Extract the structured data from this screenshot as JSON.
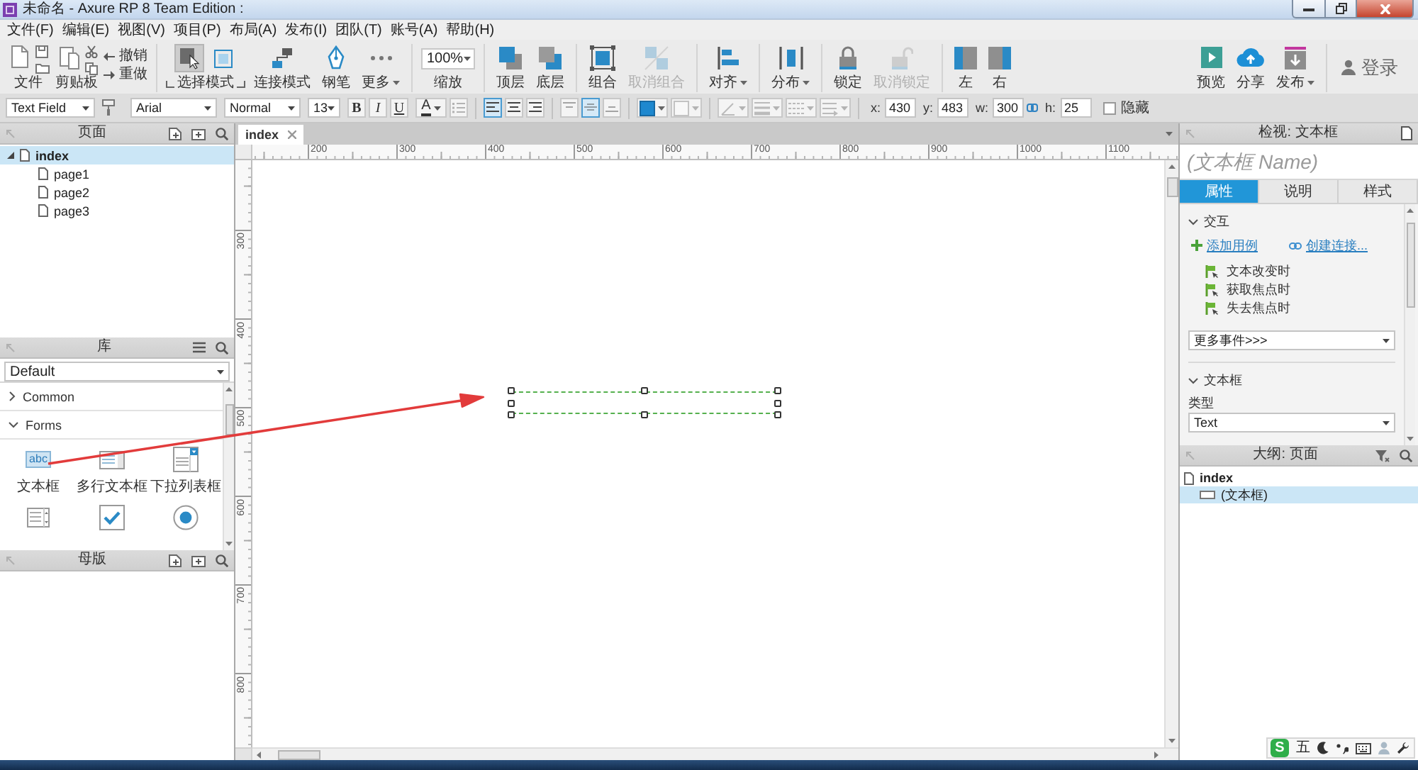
{
  "window": {
    "title": "未命名 - Axure RP 8 Team Edition :"
  },
  "menu": [
    "文件(F)",
    "编辑(E)",
    "视图(V)",
    "项目(P)",
    "布局(A)",
    "发布(I)",
    "团队(T)",
    "账号(A)",
    "帮助(H)"
  ],
  "toolbar": {
    "sections": [
      [
        {
          "kind": "file",
          "label": "文件"
        },
        {
          "kind": "clipboard",
          "label": "剪贴板"
        },
        {
          "kind": "history",
          "actions": [
            {
              "kind": "undo",
              "label": "撤销"
            },
            {
              "kind": "redo",
              "label": "重做"
            }
          ]
        }
      ],
      [
        {
          "kind": "select-mode",
          "label": "选择模式",
          "modes": [
            {
              "kind": "intersect",
              "selected": true
            },
            {
              "kind": "contain",
              "selected": false
            }
          ]
        },
        {
          "kind": "connect",
          "label": "连接模式",
          "dropdown": false,
          "disabled": false
        },
        {
          "kind": "pen",
          "label": "钢笔",
          "dropdown": false,
          "disabled": false
        },
        {
          "kind": "more",
          "label": "更多",
          "dropdown": true,
          "disabled": false
        }
      ],
      [
        {
          "kind": "zoom",
          "value": "100%",
          "label": "缩放"
        }
      ],
      [
        {
          "kind": "bring-to-front",
          "label": "顶层",
          "dropdown": false,
          "disabled": false
        },
        {
          "kind": "send-to-back",
          "label": "底层",
          "dropdown": false,
          "disabled": false
        }
      ],
      [
        {
          "kind": "group",
          "label": "组合",
          "dropdown": false,
          "disabled": false
        },
        {
          "kind": "ungroup",
          "label": "取消组合",
          "dropdown": false,
          "disabled": true
        }
      ],
      [
        {
          "kind": "align",
          "label": "对齐",
          "dropdown": true,
          "disabled": false
        }
      ],
      [
        {
          "kind": "distribute",
          "label": "分布",
          "dropdown": true,
          "disabled": false
        }
      ],
      [
        {
          "kind": "lock",
          "label": "锁定",
          "dropdown": false,
          "disabled": false
        },
        {
          "kind": "unlock",
          "label": "取消锁定",
          "dropdown": false,
          "disabled": true
        }
      ],
      [
        {
          "kind": "left-pane",
          "label": "左",
          "dropdown": false,
          "disabled": false
        },
        {
          "kind": "right-pane",
          "label": "右",
          "dropdown": false,
          "disabled": false
        }
      ]
    ],
    "right_sections": [
      [
        {
          "kind": "preview",
          "label": "预览",
          "dropdown": false,
          "disabled": false
        },
        {
          "kind": "share",
          "label": "分享",
          "dropdown": false,
          "disabled": false
        },
        {
          "kind": "publish",
          "label": "发布",
          "dropdown": true,
          "disabled": false
        }
      ],
      [
        {
          "kind": "login",
          "label": "登录"
        }
      ]
    ]
  },
  "format_bar": {
    "widget_type": "Text Field",
    "font_family": "Arial",
    "font_style": "Normal",
    "font_size": "13",
    "text_styles": [
      {
        "kind": "bold",
        "label": "B"
      },
      {
        "kind": "italic",
        "label": "I"
      },
      {
        "kind": "underline",
        "label": "U"
      }
    ],
    "font_color": "A",
    "bullets": {
      "disabled": true
    },
    "horizontal_align": [
      {
        "kind": "left",
        "selected": true
      },
      {
        "kind": "center",
        "selected": false
      },
      {
        "kind": "right",
        "selected": false
      }
    ],
    "vertical_align": [
      {
        "kind": "top",
        "selected": false,
        "disabled": true
      },
      {
        "kind": "middle",
        "selected": true,
        "disabled": true
      },
      {
        "kind": "bottom",
        "selected": false,
        "disabled": true
      }
    ],
    "style_tools": [
      {
        "kind": "fill",
        "disabled": false
      },
      {
        "kind": "border",
        "disabled": true
      },
      {
        "kind": "line",
        "disabled": true
      },
      {
        "kind": "line-weight",
        "disabled": true
      },
      {
        "kind": "line-pattern",
        "disabled": true
      },
      {
        "kind": "arrow-style",
        "disabled": true
      }
    ],
    "position": [
      {
        "kind": "x",
        "label": "x:",
        "value": "430"
      },
      {
        "kind": "y",
        "label": "y:",
        "value": "483"
      },
      {
        "kind": "w",
        "label": "w:",
        "value": "300"
      },
      {
        "kind": "h",
        "label": "h:",
        "value": "25"
      }
    ],
    "hidden": {
      "label": "隐藏",
      "checked": false
    }
  },
  "pages_panel": {
    "title": "页面",
    "tree": [
      {
        "label": "index",
        "expanded": true,
        "selected": true,
        "children": [
          {
            "label": "page1",
            "selected": false
          },
          {
            "label": "page2",
            "selected": false
          },
          {
            "label": "page3",
            "selected": false
          }
        ]
      }
    ]
  },
  "library_panel": {
    "title": "库",
    "library": "Default",
    "groups": [
      {
        "label": "Common",
        "expanded": false
      },
      {
        "label": "Forms",
        "expanded": true,
        "widgets": [
          {
            "kind": "text-field",
            "label": "文本框",
            "sample": "abc"
          },
          {
            "kind": "text-area",
            "label": "多行文本框"
          },
          {
            "kind": "droplist",
            "label": "下拉列表框"
          },
          {
            "kind": "listbox"
          },
          {
            "kind": "checkbox"
          },
          {
            "kind": "radio"
          }
        ]
      }
    ]
  },
  "masters_panel": {
    "title": "母版"
  },
  "editor": {
    "tabs": [
      {
        "label": "index",
        "selected": true
      }
    ],
    "ruler": {
      "x_labels": [
        "200",
        "300",
        "400",
        "500",
        "600",
        "700",
        "800",
        "900",
        "1000",
        "1100"
      ],
      "y_labels": [
        "300",
        "400",
        "500",
        "600",
        "700",
        "800"
      ]
    },
    "widgets": [
      {
        "kind": "text-field",
        "selected": true
      }
    ]
  },
  "inspector": {
    "title": "检视: 文本框",
    "name_placeholder": "(文本框 Name)",
    "tabs": [
      {
        "label": "属性",
        "selected": true
      },
      {
        "label": "说明",
        "selected": false
      },
      {
        "label": "样式",
        "selected": false
      }
    ],
    "sections": [
      {
        "kind": "interactions",
        "title": "交互",
        "expanded": true,
        "links": [
          {
            "kind": "add-case",
            "label": "添加用例"
          },
          {
            "kind": "create-link",
            "label": "创建连接..."
          }
        ],
        "events": [
          "文本改变时",
          "获取焦点时",
          "失去焦点时"
        ],
        "more_events": "更多事件>>>"
      },
      {
        "kind": "text-field",
        "title": "文本框",
        "expanded": true,
        "fields": [
          {
            "label": "类型",
            "value": "Text"
          }
        ]
      }
    ]
  },
  "outline_panel": {
    "title": "大纲: 页面",
    "tree": [
      {
        "label": "index",
        "selected": false,
        "children": [
          {
            "label": "(文本框)",
            "selected": true
          }
        ]
      }
    ]
  },
  "ime": {
    "logo": "S",
    "mode": "五"
  }
}
